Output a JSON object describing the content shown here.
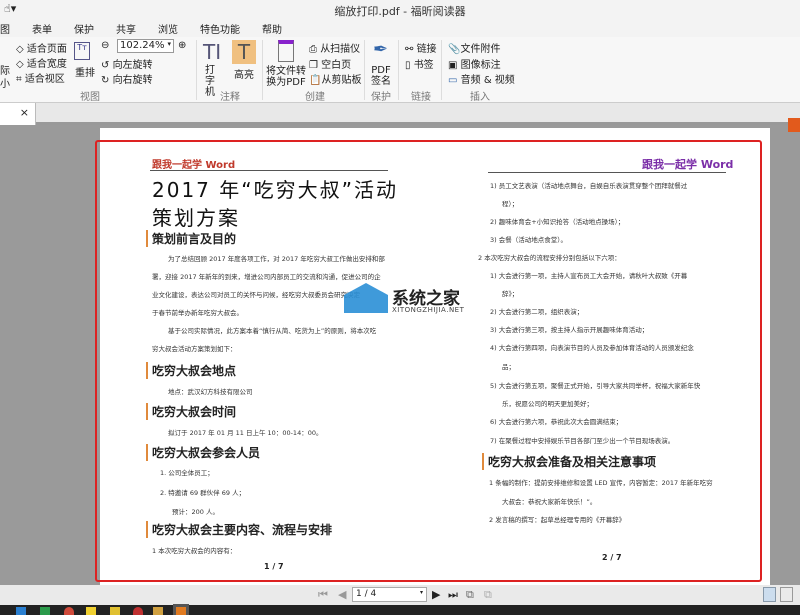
{
  "window": {
    "title": "缩放打印.pdf - 福昕阅读器"
  },
  "menu": [
    "图",
    "表单",
    "保护",
    "共享",
    "浏览",
    "特色功能",
    "帮助"
  ],
  "ribbon": {
    "view": {
      "fit_page": "适合页面",
      "fit_width": "适合宽度",
      "fit_visible": "适合视区",
      "reflow": "重排",
      "zoom": "102.24%",
      "rotate_left": "向左旋转",
      "rotate_right": "向右旋转",
      "actual_a": "际",
      "actual_b": "小",
      "group": "视图"
    },
    "comment": {
      "typewriter": "打字机",
      "highlight": "高亮",
      "group": "注释"
    },
    "create": {
      "convert": "将文件转换为PDF",
      "from_scanner": "从扫描仪",
      "blank": "空白页",
      "from_clipboard": "从剪贴板",
      "group": "创建"
    },
    "protect": {
      "sign": "PDF签名",
      "group": "保护"
    },
    "links": {
      "link": "链接",
      "bookmark": "书签",
      "group": "链接"
    },
    "insert": {
      "attachment": "文件附件",
      "image": "图像标注",
      "audio_video": "音频 & 视频",
      "group": "插入"
    }
  },
  "tab": {
    "close": "×"
  },
  "left_page": {
    "header": "跟我一起学 Word",
    "title1": "2017 年“吃穷大叔”活动",
    "title2": "策划方案",
    "s1": "策划前言及目的",
    "p1": [
      "为了总结回顾 2017 年度各项工作，对 2017 年吃穷大叔工作做出安排和部",
      "署，迎接 2017 年新年的到来，增进公司内部员工的交流和沟通，促进公司的企",
      "业文化建设，表达公司对员工的关怀与问候，经吃穷大叔委员会研究决定",
      "于春节前举办新年吃穷大叔会。"
    ],
    "p2": [
      "基于公司实际情况，此方案本着“慎行从简、吃货为上”的原则，将本次吃",
      "穷大叔会活动方案策划如下："
    ],
    "s2": "吃穷大叔会地点",
    "loc": "地点：武汉幻方科技有限公司",
    "s3": "吃穷大叔会时间",
    "time": "拟订于 2017 年 01 月 11 日上午 10：00-14：00。",
    "s4": "吃穷大叔会参会人员",
    "people": [
      "1.  公司全体员工；",
      "2.  特邀请 69 群伙伴 69 人；",
      "预计：200 人。"
    ],
    "s5": "吃穷大叔会主要内容、流程与安排",
    "c1": "1   本次吃穷大叔会的内容有：",
    "page_no": "1 / 7"
  },
  "right_page": {
    "header": "跟我一起学 Word",
    "lines": [
      "1)  员工文艺表演（活动地点舞台，自娱自乐表演贯穿整个团拜就餐过",
      "程）；",
      "2)  趣味体育会+小知识抢答（活动地点操场）；",
      "3)  会餐（活动地点食堂）。",
      "2   本次吃穷大叔会的流程安排分别包括以下六项：",
      "1)  大会进行第一项，主持人宣布员工大会开始，请秋叶大叔致《开幕",
      "辞》；",
      "2)  大会进行第二项，组织表演；",
      "3)  大会进行第三项，按主持人指示开展趣味体育活动；",
      "4)  大会进行第四项，向表演节目的人员及参加体育活动的人员颁发纪念",
      "品；",
      "5)  大会进行第五项，聚餐正式开始，引导大家共同举杯，祝福大家新年快",
      "乐，祝愿公司的明天更加美好；",
      "6)  大会进行第六项，恭祝此次大会圆满结束；",
      "7)  在聚餐过程中安排娱乐节目各部门至少出一个节目现场表演。"
    ],
    "s": "吃穷大叔会准备及相关注意事项",
    "lines2": [
      "1   条幅的制作：提前安排维修和设置 LED 宣传，内容暂定：2017 年新年吃穷",
      "大叔会：恭祝大家新年快乐！”。",
      "2   发言稿的撰写：起草总经理专用的《开幕辞》"
    ],
    "page_no": "2 / 7"
  },
  "watermark": {
    "name": "系统之家",
    "url": "XITONGZHIJIA.NET"
  },
  "nav": {
    "page": "1 / 4"
  },
  "colors": {
    "frame": "#dd2222",
    "accent": "#e08a3c",
    "header_left": "#c0392b",
    "header_right": "#7b2fa8",
    "highlight_btn": "#f0c080"
  }
}
